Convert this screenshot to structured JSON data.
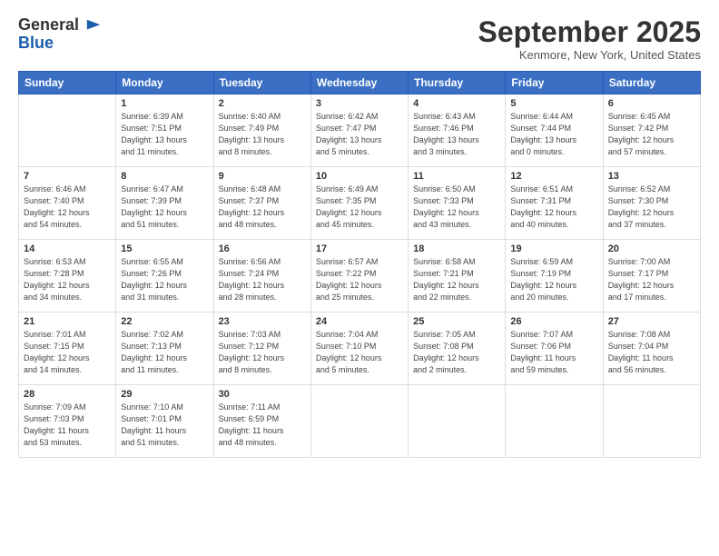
{
  "logo": {
    "general": "General",
    "blue": "Blue"
  },
  "header": {
    "month": "September 2025",
    "location": "Kenmore, New York, United States"
  },
  "days_of_week": [
    "Sunday",
    "Monday",
    "Tuesday",
    "Wednesday",
    "Thursday",
    "Friday",
    "Saturday"
  ],
  "weeks": [
    [
      {
        "day": "",
        "info": ""
      },
      {
        "day": "1",
        "info": "Sunrise: 6:39 AM\nSunset: 7:51 PM\nDaylight: 13 hours\nand 11 minutes."
      },
      {
        "day": "2",
        "info": "Sunrise: 6:40 AM\nSunset: 7:49 PM\nDaylight: 13 hours\nand 8 minutes."
      },
      {
        "day": "3",
        "info": "Sunrise: 6:42 AM\nSunset: 7:47 PM\nDaylight: 13 hours\nand 5 minutes."
      },
      {
        "day": "4",
        "info": "Sunrise: 6:43 AM\nSunset: 7:46 PM\nDaylight: 13 hours\nand 3 minutes."
      },
      {
        "day": "5",
        "info": "Sunrise: 6:44 AM\nSunset: 7:44 PM\nDaylight: 13 hours\nand 0 minutes."
      },
      {
        "day": "6",
        "info": "Sunrise: 6:45 AM\nSunset: 7:42 PM\nDaylight: 12 hours\nand 57 minutes."
      }
    ],
    [
      {
        "day": "7",
        "info": "Sunrise: 6:46 AM\nSunset: 7:40 PM\nDaylight: 12 hours\nand 54 minutes."
      },
      {
        "day": "8",
        "info": "Sunrise: 6:47 AM\nSunset: 7:39 PM\nDaylight: 12 hours\nand 51 minutes."
      },
      {
        "day": "9",
        "info": "Sunrise: 6:48 AM\nSunset: 7:37 PM\nDaylight: 12 hours\nand 48 minutes."
      },
      {
        "day": "10",
        "info": "Sunrise: 6:49 AM\nSunset: 7:35 PM\nDaylight: 12 hours\nand 45 minutes."
      },
      {
        "day": "11",
        "info": "Sunrise: 6:50 AM\nSunset: 7:33 PM\nDaylight: 12 hours\nand 43 minutes."
      },
      {
        "day": "12",
        "info": "Sunrise: 6:51 AM\nSunset: 7:31 PM\nDaylight: 12 hours\nand 40 minutes."
      },
      {
        "day": "13",
        "info": "Sunrise: 6:52 AM\nSunset: 7:30 PM\nDaylight: 12 hours\nand 37 minutes."
      }
    ],
    [
      {
        "day": "14",
        "info": "Sunrise: 6:53 AM\nSunset: 7:28 PM\nDaylight: 12 hours\nand 34 minutes."
      },
      {
        "day": "15",
        "info": "Sunrise: 6:55 AM\nSunset: 7:26 PM\nDaylight: 12 hours\nand 31 minutes."
      },
      {
        "day": "16",
        "info": "Sunrise: 6:56 AM\nSunset: 7:24 PM\nDaylight: 12 hours\nand 28 minutes."
      },
      {
        "day": "17",
        "info": "Sunrise: 6:57 AM\nSunset: 7:22 PM\nDaylight: 12 hours\nand 25 minutes."
      },
      {
        "day": "18",
        "info": "Sunrise: 6:58 AM\nSunset: 7:21 PM\nDaylight: 12 hours\nand 22 minutes."
      },
      {
        "day": "19",
        "info": "Sunrise: 6:59 AM\nSunset: 7:19 PM\nDaylight: 12 hours\nand 20 minutes."
      },
      {
        "day": "20",
        "info": "Sunrise: 7:00 AM\nSunset: 7:17 PM\nDaylight: 12 hours\nand 17 minutes."
      }
    ],
    [
      {
        "day": "21",
        "info": "Sunrise: 7:01 AM\nSunset: 7:15 PM\nDaylight: 12 hours\nand 14 minutes."
      },
      {
        "day": "22",
        "info": "Sunrise: 7:02 AM\nSunset: 7:13 PM\nDaylight: 12 hours\nand 11 minutes."
      },
      {
        "day": "23",
        "info": "Sunrise: 7:03 AM\nSunset: 7:12 PM\nDaylight: 12 hours\nand 8 minutes."
      },
      {
        "day": "24",
        "info": "Sunrise: 7:04 AM\nSunset: 7:10 PM\nDaylight: 12 hours\nand 5 minutes."
      },
      {
        "day": "25",
        "info": "Sunrise: 7:05 AM\nSunset: 7:08 PM\nDaylight: 12 hours\nand 2 minutes."
      },
      {
        "day": "26",
        "info": "Sunrise: 7:07 AM\nSunset: 7:06 PM\nDaylight: 11 hours\nand 59 minutes."
      },
      {
        "day": "27",
        "info": "Sunrise: 7:08 AM\nSunset: 7:04 PM\nDaylight: 11 hours\nand 56 minutes."
      }
    ],
    [
      {
        "day": "28",
        "info": "Sunrise: 7:09 AM\nSunset: 7:03 PM\nDaylight: 11 hours\nand 53 minutes."
      },
      {
        "day": "29",
        "info": "Sunrise: 7:10 AM\nSunset: 7:01 PM\nDaylight: 11 hours\nand 51 minutes."
      },
      {
        "day": "30",
        "info": "Sunrise: 7:11 AM\nSunset: 6:59 PM\nDaylight: 11 hours\nand 48 minutes."
      },
      {
        "day": "",
        "info": ""
      },
      {
        "day": "",
        "info": ""
      },
      {
        "day": "",
        "info": ""
      },
      {
        "day": "",
        "info": ""
      }
    ]
  ]
}
